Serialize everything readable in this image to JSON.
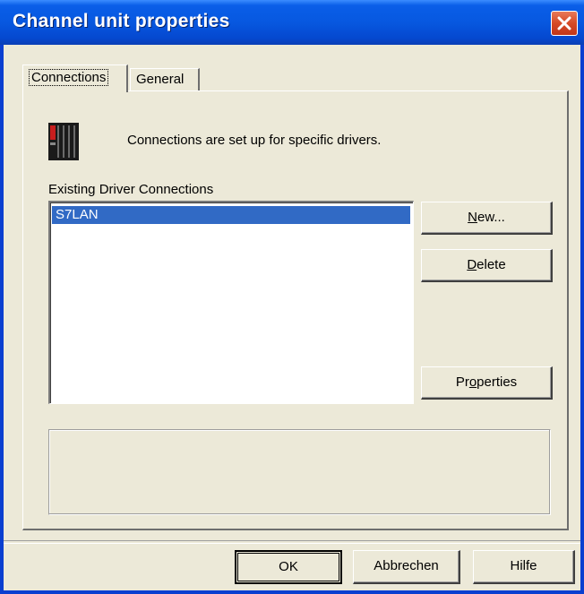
{
  "window": {
    "title": "Channel unit properties"
  },
  "tabs": [
    {
      "label": "Connections",
      "selected": true
    },
    {
      "label": "General",
      "selected": false
    }
  ],
  "connections": {
    "info_text": "Connections are set up for specific drivers.",
    "list_label": "Existing Driver Connections",
    "items": [
      {
        "label": "S7LAN",
        "selected": true
      }
    ]
  },
  "side_buttons": {
    "new": {
      "label_pre": "",
      "label_mnemonic": "N",
      "label_post": "ew..."
    },
    "delete": {
      "label_pre": "",
      "label_mnemonic": "D",
      "label_post": "elete"
    },
    "properties": {
      "label_pre": "Pr",
      "label_mnemonic": "o",
      "label_post": "perties"
    }
  },
  "footer_buttons": {
    "ok": "OK",
    "cancel": "Abbrechen",
    "help": "Hilfe"
  },
  "colors": {
    "titlebar": "#0758e0",
    "selection": "#316ac5",
    "close": "#d64a26",
    "face": "#ece9d8"
  },
  "icons": {
    "close": "close-icon",
    "driver": "driver-connection-icon"
  }
}
